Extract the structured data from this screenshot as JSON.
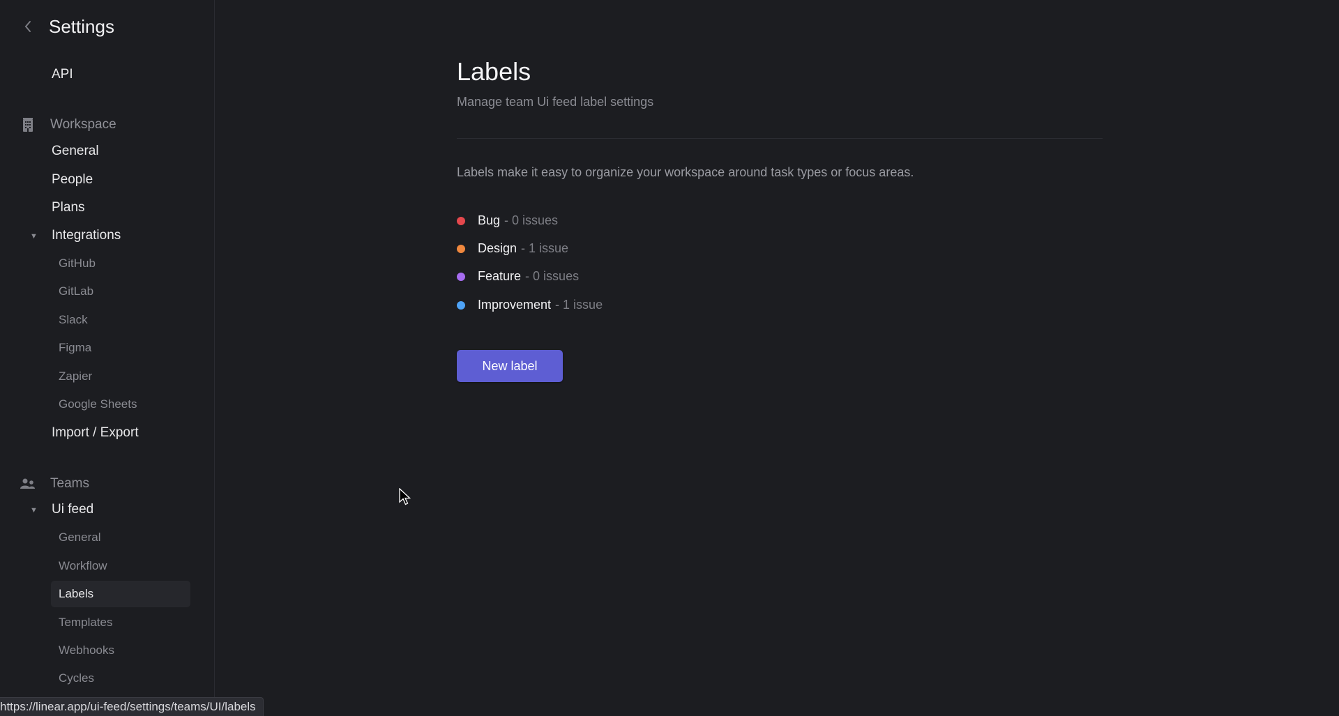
{
  "sidebar": {
    "title": "Settings",
    "back_icon": "chevron-left-icon",
    "api_label": "API",
    "workspace": {
      "label": "Workspace",
      "icon": "building-icon",
      "items": [
        {
          "label": "General"
        },
        {
          "label": "People"
        },
        {
          "label": "Plans"
        }
      ],
      "integrations": {
        "label": "Integrations",
        "expanded": true,
        "items": [
          {
            "label": "GitHub"
          },
          {
            "label": "GitLab"
          },
          {
            "label": "Slack"
          },
          {
            "label": "Figma"
          },
          {
            "label": "Zapier"
          },
          {
            "label": "Google Sheets"
          }
        ]
      },
      "import_export": "Import / Export"
    },
    "teams": {
      "label": "Teams",
      "icon": "people-icon",
      "team": {
        "label": "Ui feed",
        "expanded": true,
        "items": [
          {
            "label": "General",
            "active": false
          },
          {
            "label": "Workflow",
            "active": false
          },
          {
            "label": "Labels",
            "active": true
          },
          {
            "label": "Templates",
            "active": false
          },
          {
            "label": "Webhooks",
            "active": false
          },
          {
            "label": "Cycles",
            "active": false
          }
        ]
      }
    }
  },
  "main": {
    "title": "Labels",
    "subtitle": "Manage team Ui feed label settings",
    "description": "Labels make it easy to organize your workspace around task types or focus areas.",
    "labels": [
      {
        "name": "Bug",
        "count": "- 0 issues",
        "color": "#e5484d"
      },
      {
        "name": "Design",
        "count": "- 1 issue",
        "color": "#f0883e"
      },
      {
        "name": "Feature",
        "count": "- 0 issues",
        "color": "#a66cf0"
      },
      {
        "name": "Improvement",
        "count": "- 1 issue",
        "color": "#4ea3f7"
      }
    ],
    "new_label_button": "New label",
    "accent_color": "#5e5ed3"
  },
  "statusbar": {
    "url": "https://linear.app/ui-feed/settings/teams/UI/labels"
  }
}
